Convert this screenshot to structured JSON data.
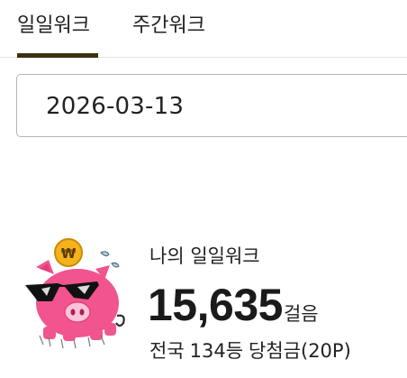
{
  "tabs": [
    {
      "label": "일일워크",
      "active": true
    },
    {
      "label": "주간워크",
      "active": false
    }
  ],
  "date": {
    "value": "2026-03-13"
  },
  "mascot": {
    "icon": "pig-mascot-with-won-coin-icon",
    "coin_symbol": "₩"
  },
  "summary": {
    "title": "나의 일일워크",
    "steps_value": "15,635",
    "steps_unit": "걸음",
    "rank_prefix": "전국",
    "rank_value": "134등",
    "prize_text": "당첨금(20P)"
  },
  "colors": {
    "tab_underline": "#3d2f10",
    "pig_pink": "#f2548f",
    "coin_gold": "#f6b21a"
  }
}
